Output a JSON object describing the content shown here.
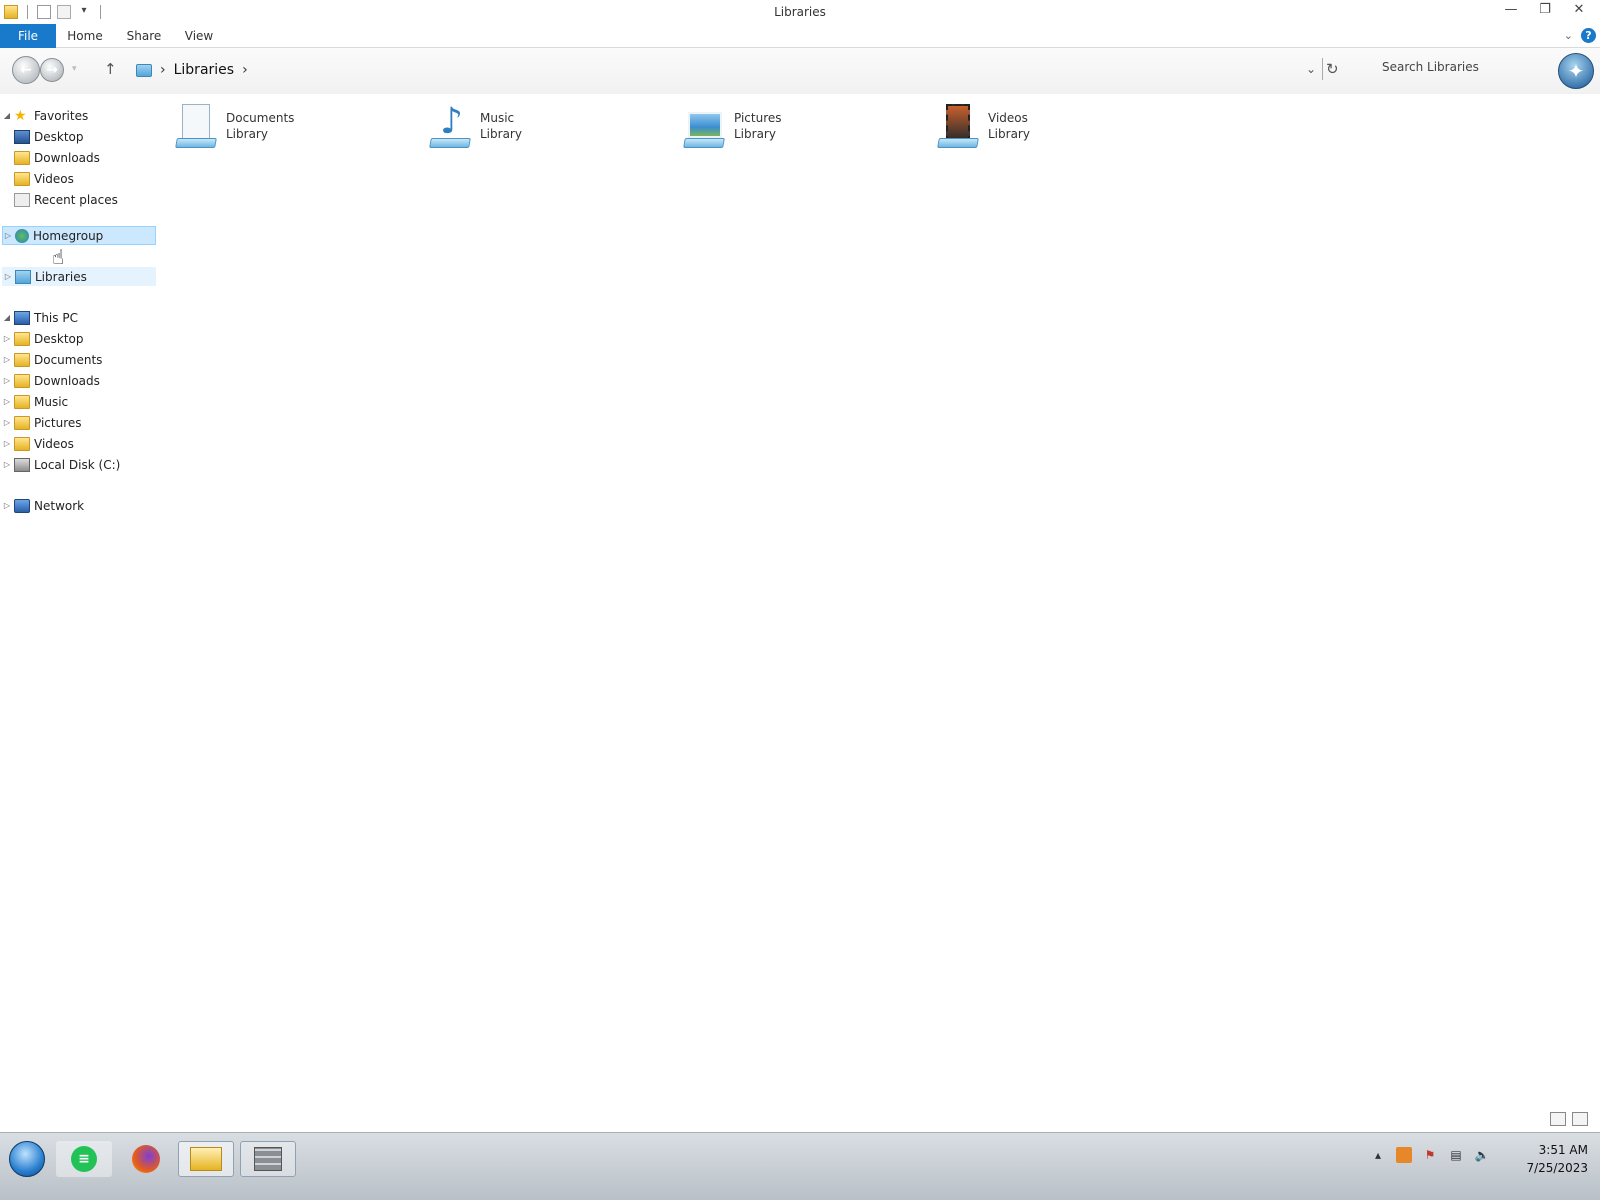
{
  "window": {
    "title": "Libraries"
  },
  "ribbon": {
    "tabs": [
      {
        "label": "File"
      },
      {
        "label": "Home"
      },
      {
        "label": "Share"
      },
      {
        "label": "View"
      }
    ]
  },
  "address": {
    "breadcrumb": [
      "Libraries"
    ],
    "search_placeholder": "Search Libraries"
  },
  "navpane": {
    "favorites": {
      "label": "Favorites",
      "items": [
        "Desktop",
        "Downloads",
        "Videos",
        "Recent places"
      ]
    },
    "homegroup": {
      "label": "Homegroup"
    },
    "libraries": {
      "label": "Libraries"
    },
    "thispc": {
      "label": "This PC",
      "items": [
        "Desktop",
        "Documents",
        "Downloads",
        "Music",
        "Pictures",
        "Videos",
        "Local Disk (C:)"
      ]
    },
    "network": {
      "label": "Network"
    }
  },
  "content": {
    "libraries": [
      {
        "name": "Documents",
        "type": "Library",
        "icon": "documents-library-icon"
      },
      {
        "name": "Music",
        "type": "Library",
        "icon": "music-library-icon"
      },
      {
        "name": "Pictures",
        "type": "Library",
        "icon": "pictures-library-icon"
      },
      {
        "name": "Videos",
        "type": "Library",
        "icon": "videos-library-icon"
      }
    ]
  },
  "taskbar": {
    "time": "3:51 AM",
    "date": "7/25/2023"
  },
  "colors": {
    "accent": "#1979ca",
    "selection": "#cce8ff"
  }
}
